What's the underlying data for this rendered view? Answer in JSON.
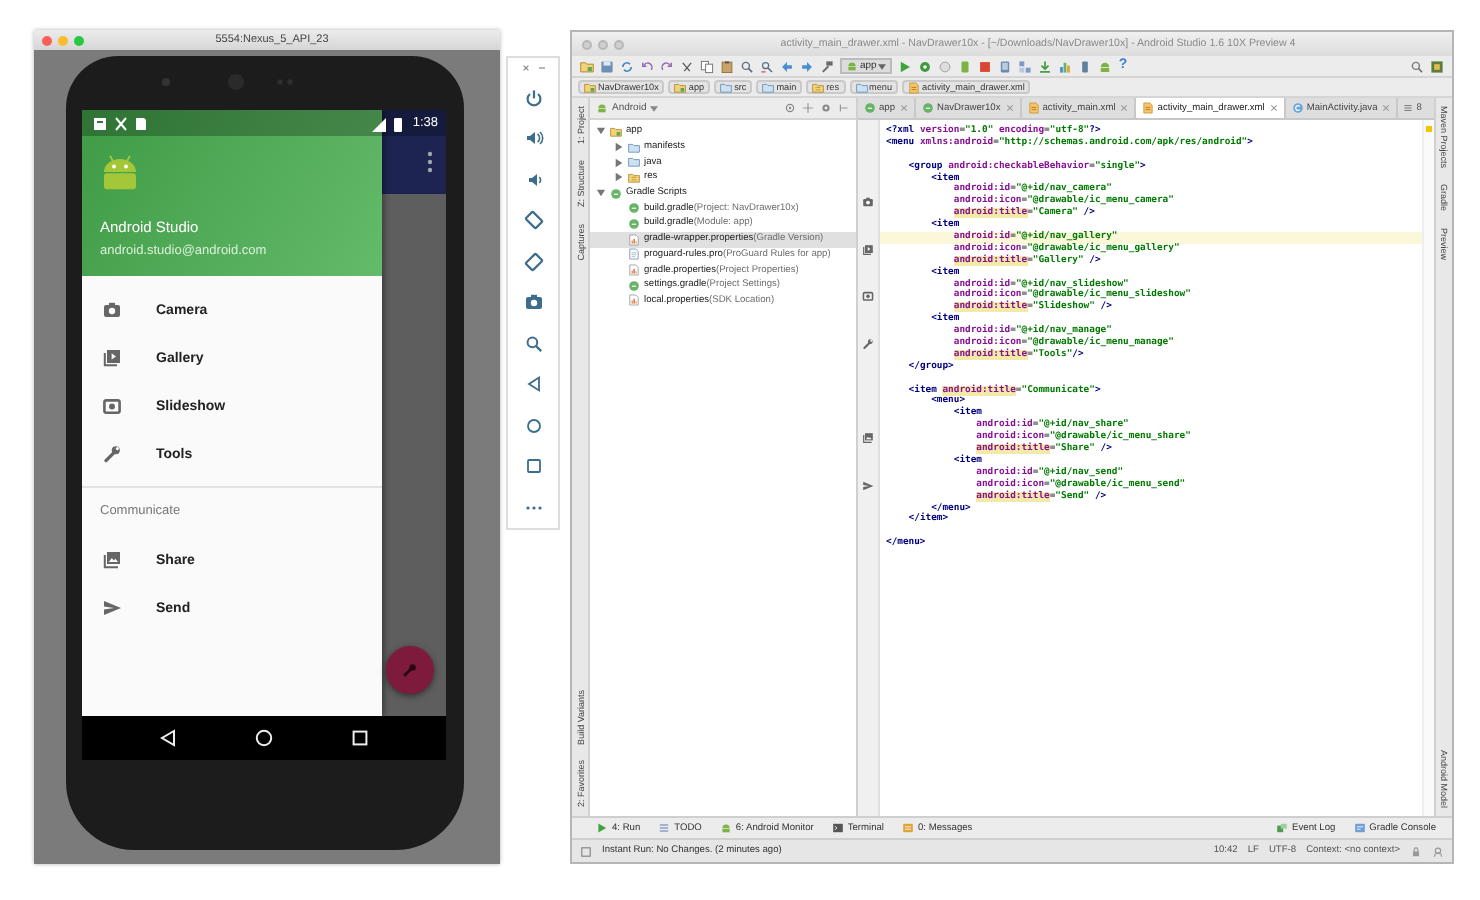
{
  "emulator": {
    "title": "5554:Nexus_5_API_23",
    "clock": "1:38",
    "profile": {
      "name": "Android Studio",
      "email": "android.studio@android.com"
    },
    "menu": [
      {
        "label": "Camera",
        "kind": "camera"
      },
      {
        "label": "Gallery",
        "kind": "gallery"
      },
      {
        "label": "Slideshow",
        "kind": "slideshow"
      },
      {
        "label": "Tools",
        "kind": "wrench"
      }
    ],
    "section": "Communicate",
    "section_items": [
      {
        "label": "Share",
        "kind": "share"
      },
      {
        "label": "Send",
        "kind": "send"
      }
    ]
  },
  "studio": {
    "title": "activity_main_drawer.xml - NavDrawer10x - [~/Downloads/NavDrawer10x] - Android Studio 1.6 10X Preview 4",
    "run_config": "app",
    "help": "?",
    "breadcrumbs": [
      {
        "label": "NavDrawer10x",
        "kind": "module"
      },
      {
        "label": "app",
        "kind": "module"
      },
      {
        "label": "src",
        "kind": "folder"
      },
      {
        "label": "main",
        "kind": "folder"
      },
      {
        "label": "res",
        "kind": "res-folder"
      },
      {
        "label": "menu",
        "kind": "folder"
      },
      {
        "label": "activity_main_drawer.xml",
        "kind": "xml"
      }
    ],
    "left_strip_top": [
      "1: Project",
      "Z: Structure",
      "Captures"
    ],
    "left_strip_bottom": [
      "Build Variants",
      "2: Favorites"
    ],
    "right_strip_top": [
      "Maven Projects",
      "Gradle",
      "Preview"
    ],
    "right_strip_bottom": [
      "Android Model"
    ],
    "project_view": "Android",
    "tree": [
      {
        "label": "app",
        "kind": "module",
        "expanded": true,
        "selected": false,
        "children": [
          {
            "label": "manifests",
            "kind": "folder",
            "expanded": false,
            "selected": false
          },
          {
            "label": "java",
            "kind": "folder",
            "expanded": false,
            "selected": false
          },
          {
            "label": "res",
            "kind": "res-folder",
            "expanded": false,
            "selected": false
          }
        ]
      },
      {
        "label": "Gradle Scripts",
        "kind": "gradle",
        "expanded": true,
        "selected": false,
        "children": [
          {
            "label": "build.gradle",
            "note": "(Project: NavDrawer10x)",
            "kind": "gradle",
            "selected": false
          },
          {
            "label": "build.gradle",
            "note": "(Module: app)",
            "kind": "gradle",
            "selected": false
          },
          {
            "label": "gradle-wrapper.properties",
            "note": "(Gradle Version)",
            "kind": "properties",
            "selected": true
          },
          {
            "label": "proguard-rules.pro",
            "note": "(ProGuard Rules for app)",
            "kind": "text-file",
            "selected": false
          },
          {
            "label": "gradle.properties",
            "note": "(Project Properties)",
            "kind": "properties",
            "selected": false
          },
          {
            "label": "settings.gradle",
            "note": "(Project Settings)",
            "kind": "gradle",
            "selected": false
          },
          {
            "label": "local.properties",
            "note": "(SDK Location)",
            "kind": "properties",
            "selected": false
          }
        ]
      }
    ],
    "tabs": [
      {
        "label": "app",
        "kind": "gradle",
        "selected": false
      },
      {
        "label": "NavDrawer10x",
        "kind": "gradle",
        "selected": false
      },
      {
        "label": "activity_main.xml",
        "kind": "xml",
        "selected": false
      },
      {
        "label": "activity_main_drawer.xml",
        "kind": "xml",
        "selected": true
      },
      {
        "label": "MainActivity.java",
        "kind": "class",
        "selected": false
      }
    ],
    "tab_overflow": "8",
    "code": [
      {
        "current": false,
        "tokens": [
          {
            "kind": "tag",
            "text": "<?xml "
          },
          {
            "kind": "attr",
            "text": "version"
          },
          {
            "kind": "plain",
            "text": "="
          },
          {
            "kind": "value",
            "text": "\"1.0\" "
          },
          {
            "kind": "attr",
            "text": "encoding"
          },
          {
            "kind": "plain",
            "text": "="
          },
          {
            "kind": "value",
            "text": "\"utf-8\""
          },
          {
            "kind": "tag",
            "text": "?>"
          }
        ]
      },
      {
        "current": false,
        "tokens": [
          {
            "kind": "tag",
            "text": "<menu "
          },
          {
            "kind": "attr",
            "text": "xmlns:android"
          },
          {
            "kind": "plain",
            "text": "="
          },
          {
            "kind": "value",
            "text": "\"http://schemas.android.com/apk/res/android\""
          },
          {
            "kind": "tag",
            "text": ">"
          }
        ]
      },
      {
        "current": false,
        "gap_before": true,
        "tokens": [
          {
            "kind": "tag",
            "text": "    <group "
          },
          {
            "kind": "attr",
            "text": "android:checkableBehavior"
          },
          {
            "kind": "plain",
            "text": "="
          },
          {
            "kind": "value",
            "text": "\"single\""
          },
          {
            "kind": "tag",
            "text": ">"
          }
        ]
      },
      {
        "current": false,
        "tokens": [
          {
            "kind": "tag",
            "text": "        <item"
          }
        ]
      },
      {
        "current": false,
        "tokens": [
          {
            "kind": "attr",
            "text": "            android:id"
          },
          {
            "kind": "plain",
            "text": "="
          },
          {
            "kind": "value",
            "text": "\"@+id/nav_camera\""
          }
        ]
      },
      {
        "current": false,
        "gutter": {
          "kind": "camera"
        },
        "tokens": [
          {
            "kind": "attr",
            "text": "            android:icon"
          },
          {
            "kind": "plain",
            "text": "="
          },
          {
            "kind": "value",
            "text": "\"@drawable/ic_menu_camera\""
          }
        ]
      },
      {
        "current": false,
        "tokens": [
          {
            "kind": "title",
            "text": "            android:title"
          },
          {
            "kind": "plain",
            "text": "="
          },
          {
            "kind": "value",
            "text": "\"Camera\""
          },
          {
            "kind": "tag",
            "text": " />"
          }
        ]
      },
      {
        "current": false,
        "tokens": [
          {
            "kind": "tag",
            "text": "        <item"
          }
        ]
      },
      {
        "current": true,
        "tokens": [
          {
            "kind": "attr",
            "text": "            android:id"
          },
          {
            "kind": "plain",
            "text": "="
          },
          {
            "kind": "value",
            "text": "\"@+id/nav_gallery\""
          }
        ]
      },
      {
        "current": false,
        "gutter": {
          "kind": "gallery"
        },
        "tokens": [
          {
            "kind": "attr",
            "text": "            android:icon"
          },
          {
            "kind": "plain",
            "text": "="
          },
          {
            "kind": "value",
            "text": "\"@drawable/ic_menu_gallery\""
          }
        ]
      },
      {
        "current": false,
        "tokens": [
          {
            "kind": "title",
            "text": "            android:title"
          },
          {
            "kind": "plain",
            "text": "="
          },
          {
            "kind": "value",
            "text": "\"Gallery\""
          },
          {
            "kind": "tag",
            "text": " />"
          }
        ]
      },
      {
        "current": false,
        "tokens": [
          {
            "kind": "tag",
            "text": "        <item"
          }
        ]
      },
      {
        "current": false,
        "tokens": [
          {
            "kind": "attr",
            "text": "            android:id"
          },
          {
            "kind": "plain",
            "text": "="
          },
          {
            "kind": "value",
            "text": "\"@+id/nav_slideshow\""
          }
        ]
      },
      {
        "current": false,
        "gutter": {
          "kind": "slideshow"
        },
        "tokens": [
          {
            "kind": "attr",
            "text": "            android:icon"
          },
          {
            "kind": "plain",
            "text": "="
          },
          {
            "kind": "value",
            "text": "\"@drawable/ic_menu_slideshow\""
          }
        ]
      },
      {
        "current": false,
        "tokens": [
          {
            "kind": "title",
            "text": "            android:title"
          },
          {
            "kind": "plain",
            "text": "="
          },
          {
            "kind": "value",
            "text": "\"Slideshow\""
          },
          {
            "kind": "tag",
            "text": " />"
          }
        ]
      },
      {
        "current": false,
        "tokens": [
          {
            "kind": "tag",
            "text": "        <item"
          }
        ]
      },
      {
        "current": false,
        "tokens": [
          {
            "kind": "attr",
            "text": "            android:id"
          },
          {
            "kind": "plain",
            "text": "="
          },
          {
            "kind": "value",
            "text": "\"@+id/nav_manage\""
          }
        ]
      },
      {
        "current": false,
        "gutter": {
          "kind": "wrench"
        },
        "tokens": [
          {
            "kind": "attr",
            "text": "            android:icon"
          },
          {
            "kind": "plain",
            "text": "="
          },
          {
            "kind": "value",
            "text": "\"@drawable/ic_menu_manage\""
          }
        ]
      },
      {
        "current": false,
        "tokens": [
          {
            "kind": "title",
            "text": "            android:title"
          },
          {
            "kind": "plain",
            "text": "="
          },
          {
            "kind": "value",
            "text": "\"Tools\""
          },
          {
            "kind": "tag",
            "text": "/>"
          }
        ]
      },
      {
        "current": false,
        "tokens": [
          {
            "kind": "tag",
            "text": "    </group>"
          }
        ]
      },
      {
        "current": false,
        "gap_before": true,
        "tokens": [
          {
            "kind": "tag",
            "text": "    <item "
          },
          {
            "kind": "title",
            "text": "android:title"
          },
          {
            "kind": "plain",
            "text": "="
          },
          {
            "kind": "value",
            "text": "\"Communicate\""
          },
          {
            "kind": "tag",
            "text": ">"
          }
        ]
      },
      {
        "current": false,
        "tokens": [
          {
            "kind": "tag",
            "text": "        <menu>"
          }
        ]
      },
      {
        "current": false,
        "tokens": [
          {
            "kind": "tag",
            "text": "            <item"
          }
        ]
      },
      {
        "current": false,
        "tokens": [
          {
            "kind": "attr",
            "text": "                android:id"
          },
          {
            "kind": "plain",
            "text": "="
          },
          {
            "kind": "value",
            "text": "\"@+id/nav_share\""
          }
        ]
      },
      {
        "current": false,
        "gutter": {
          "kind": "share"
        },
        "tokens": [
          {
            "kind": "attr",
            "text": "                android:icon"
          },
          {
            "kind": "plain",
            "text": "="
          },
          {
            "kind": "value",
            "text": "\"@drawable/ic_menu_share\""
          }
        ]
      },
      {
        "current": false,
        "tokens": [
          {
            "kind": "title",
            "text": "                android:title"
          },
          {
            "kind": "plain",
            "text": "="
          },
          {
            "kind": "value",
            "text": "\"Share\""
          },
          {
            "kind": "tag",
            "text": " />"
          }
        ]
      },
      {
        "current": false,
        "tokens": [
          {
            "kind": "tag",
            "text": "            <item"
          }
        ]
      },
      {
        "current": false,
        "tokens": [
          {
            "kind": "attr",
            "text": "                android:id"
          },
          {
            "kind": "plain",
            "text": "="
          },
          {
            "kind": "value",
            "text": "\"@+id/nav_send\""
          }
        ]
      },
      {
        "current": false,
        "gutter": {
          "kind": "send"
        },
        "tokens": [
          {
            "kind": "attr",
            "text": "                android:icon"
          },
          {
            "kind": "plain",
            "text": "="
          },
          {
            "kind": "value",
            "text": "\"@drawable/ic_menu_send\""
          }
        ]
      },
      {
        "current": false,
        "tokens": [
          {
            "kind": "title",
            "text": "                android:title"
          },
          {
            "kind": "plain",
            "text": "="
          },
          {
            "kind": "value",
            "text": "\"Send\""
          },
          {
            "kind": "tag",
            "text": " />"
          }
        ]
      },
      {
        "current": false,
        "tokens": [
          {
            "kind": "tag",
            "text": "        </menu>"
          }
        ]
      },
      {
        "current": false,
        "tokens": [
          {
            "kind": "tag",
            "text": "    </item>"
          }
        ]
      },
      {
        "current": false,
        "gap_before": true,
        "tokens": [
          {
            "kind": "tag",
            "text": "</menu>"
          }
        ]
      }
    ],
    "tool_tabs_left": [
      {
        "label": "4: Run",
        "kind": "run"
      },
      {
        "label": "TODO",
        "kind": "todo"
      },
      {
        "label": "6: Android Monitor",
        "kind": "android"
      },
      {
        "label": "Terminal",
        "kind": "terminal"
      },
      {
        "label": "0: Messages",
        "kind": "messages"
      }
    ],
    "tool_tabs_right": [
      {
        "label": "Event Log",
        "kind": "event-log"
      },
      {
        "label": "Gradle Console",
        "kind": "console"
      }
    ],
    "status": {
      "message": "Instant Run: No Changes. (2 minutes ago)",
      "items": [
        "10:42",
        "LF",
        "UTF-8",
        "Context: <no context>"
      ]
    }
  }
}
